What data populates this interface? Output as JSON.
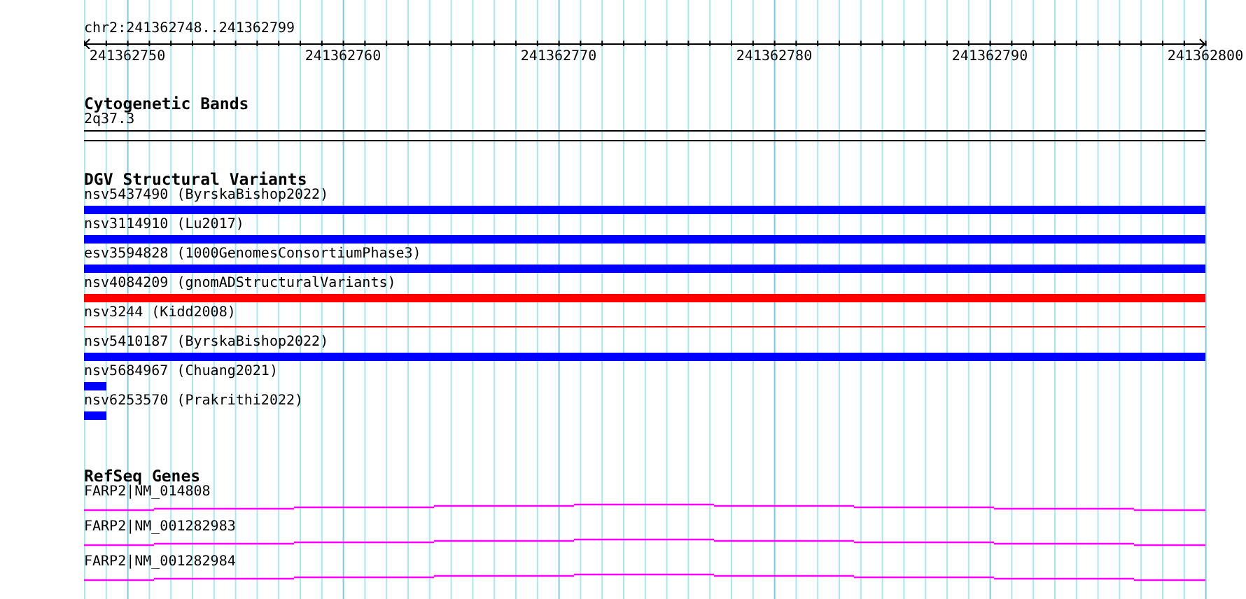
{
  "location": "chr2:241362748..241362799",
  "ruler": {
    "labels": [
      "241362750",
      "241362760",
      "241362770",
      "241362780",
      "241362790",
      "241362800"
    ]
  },
  "tracks": [
    {
      "kind": "bands",
      "title": "Cytogenetic Bands",
      "items": [
        {
          "label": "2q37.3"
        }
      ]
    },
    {
      "kind": "variants",
      "title": "DGV Structural Variants",
      "items": [
        {
          "label": "nsv5437490 (ByrskaBishop2022)",
          "color": "#0000ff",
          "kind": "thick"
        },
        {
          "label": "nsv3114910 (Lu2017)",
          "color": "#0000ff",
          "kind": "thick"
        },
        {
          "label": "esv3594828 (1000GenomesConsortiumPhase3)",
          "color": "#0000ff",
          "kind": "thick"
        },
        {
          "label": "nsv4084209 (gnomADStructuralVariants)",
          "color": "#ff0000",
          "kind": "thick"
        },
        {
          "label": "nsv3244 (Kidd2008)",
          "color": "#ff0000",
          "kind": "thin"
        },
        {
          "label": "nsv5410187 (ByrskaBishop2022)",
          "color": "#0000ff",
          "kind": "thick"
        },
        {
          "label": "nsv5684967 (Chuang2021)",
          "color": "#0000ff",
          "kind": "short"
        },
        {
          "label": "nsv6253570 (Prakrithi2022)",
          "color": "#0000ff",
          "kind": "short"
        }
      ]
    },
    {
      "kind": "genes",
      "title": "RefSeq Genes",
      "items": [
        {
          "label": "FARP2|NM_014808"
        },
        {
          "label": "FARP2|NM_001282983"
        },
        {
          "label": "FARP2|NM_001282984"
        }
      ]
    }
  ]
}
